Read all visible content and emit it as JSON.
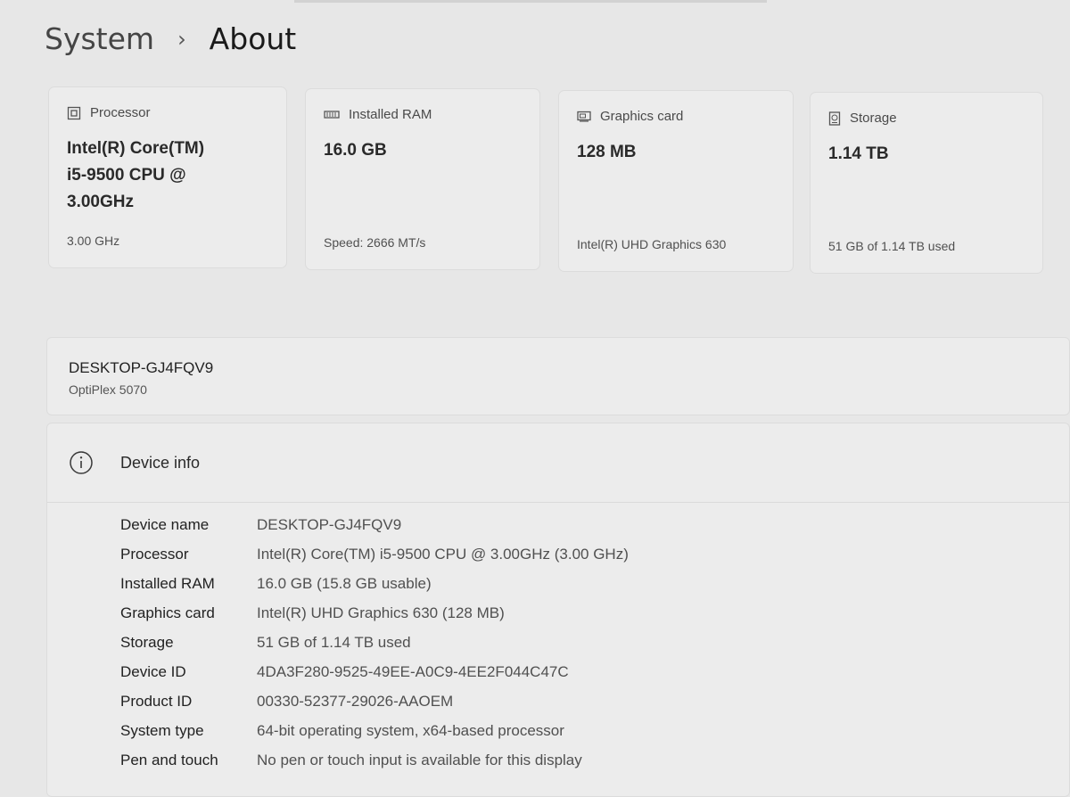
{
  "breadcrumb": {
    "root": "System",
    "separator": "›",
    "current": "About"
  },
  "cards": [
    {
      "icon": "processor-icon",
      "title": "Processor",
      "value": [
        "Intel(R) Core(TM)",
        "i5-9500 CPU @",
        "3.00GHz"
      ],
      "sub": "3.00 GHz"
    },
    {
      "icon": "ram-icon",
      "title": "Installed RAM",
      "value": [
        "16.0 GB"
      ],
      "sub": "Speed: 2666 MT/s"
    },
    {
      "icon": "graphics-card-icon",
      "title": "Graphics card",
      "value": [
        "128 MB"
      ],
      "sub": "Intel(R) UHD Graphics 630"
    },
    {
      "icon": "storage-icon",
      "title": "Storage",
      "value": [
        "1.14 TB"
      ],
      "sub": "51 GB of 1.14 TB used"
    }
  ],
  "device": {
    "name": "DESKTOP-GJ4FQV9",
    "model": "OptiPlex 5070"
  },
  "device_info": {
    "icon": "info-icon",
    "title": "Device info",
    "specs": [
      {
        "label": "Device name",
        "value": "DESKTOP-GJ4FQV9"
      },
      {
        "label": "Processor",
        "value": "Intel(R) Core(TM) i5-9500 CPU @ 3.00GHz (3.00 GHz)"
      },
      {
        "label": "Installed RAM",
        "value": "16.0 GB (15.8 GB usable)"
      },
      {
        "label": "Graphics card",
        "value": "Intel(R) UHD Graphics 630 (128 MB)"
      },
      {
        "label": "Storage",
        "value": "51 GB of 1.14 TB used"
      },
      {
        "label": "Device ID",
        "value": "4DA3F280-9525-49EE-A0C9-4EE2F044C47C"
      },
      {
        "label": "Product ID",
        "value": "00330-52377-29026-AAOEM"
      },
      {
        "label": "System type",
        "value": "64-bit operating system, x64-based processor"
      },
      {
        "label": "Pen and touch",
        "value": "No pen or touch input is available for this display"
      }
    ]
  }
}
